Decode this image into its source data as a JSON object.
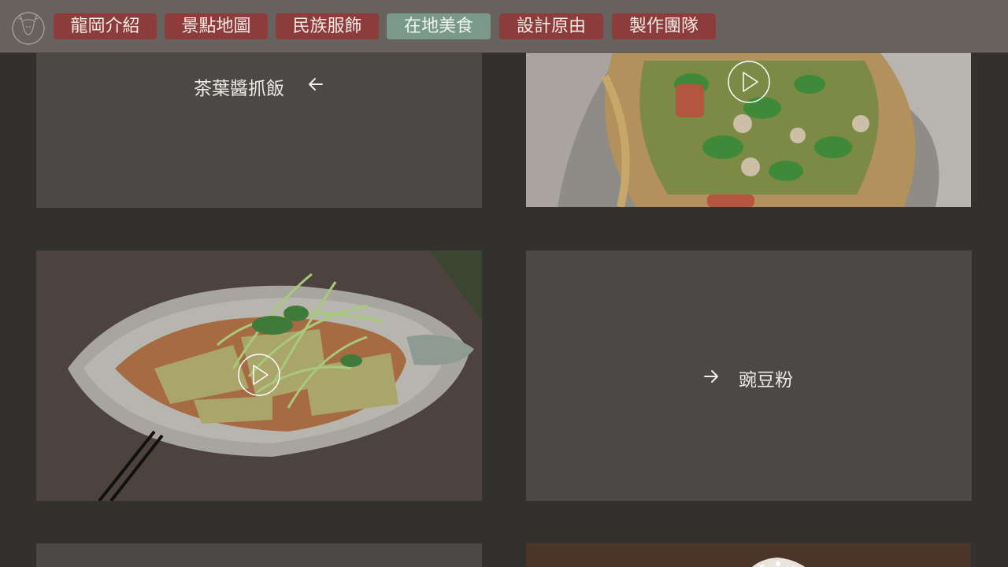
{
  "nav": {
    "logo_icon": "deer-head-logo-icon",
    "items": [
      {
        "label": "龍岡介紹",
        "active": false
      },
      {
        "label": "景點地圖",
        "active": false
      },
      {
        "label": "民族服飾",
        "active": false
      },
      {
        "label": "在地美食",
        "active": true
      },
      {
        "label": "設計原由",
        "active": false
      },
      {
        "label": "製作團隊",
        "active": false
      }
    ]
  },
  "cards": {
    "tea_leaf_rice": {
      "label": "茶葉醬抓飯",
      "arrow_icon": "arrow-left-icon"
    },
    "pea_noodle": {
      "label": "豌豆粉",
      "arrow_icon": "arrow-right-icon"
    }
  },
  "videos": {
    "fried_bread_play_icon": "play-icon",
    "bamboo_shoot_play_icon": "play-icon"
  },
  "colors": {
    "nav_bg": "#67625e",
    "nav_button": "#8c3c3a",
    "nav_button_active": "#7a998a",
    "page_bg": "#33312d",
    "card_bg": "#4c4845"
  }
}
